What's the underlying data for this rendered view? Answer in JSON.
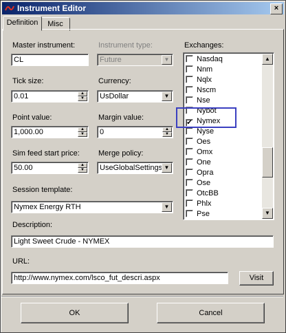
{
  "window": {
    "title": "Instrument Editor",
    "close_glyph": "×"
  },
  "tabs": [
    "Definition",
    "Misc"
  ],
  "form": {
    "master_instrument": {
      "label": "Master instrument:",
      "value": "CL"
    },
    "instrument_type": {
      "label": "Instrument type:",
      "value": "Future"
    },
    "tick_size": {
      "label": "Tick size:",
      "value": "0.01"
    },
    "currency": {
      "label": "Currency:",
      "value": "UsDollar"
    },
    "point_value": {
      "label": "Point value:",
      "value": "1,000.00"
    },
    "margin_value": {
      "label": "Margin value:",
      "value": "0"
    },
    "sim_feed_start_price": {
      "label": "Sim feed start price:",
      "value": "50.00"
    },
    "merge_policy": {
      "label": "Merge policy:",
      "value": "UseGlobalSettings"
    },
    "session_template": {
      "label": "Session template:",
      "value": "Nymex Energy RTH"
    },
    "description": {
      "label": "Description:",
      "value": "Light Sweet Crude - NYMEX"
    },
    "url": {
      "label": "URL:",
      "value": "http://www.nymex.com/lsco_fut_descri.aspx"
    }
  },
  "exchanges": {
    "label": "Exchanges:",
    "items": [
      {
        "name": "Nasdaq",
        "checked": false
      },
      {
        "name": "Nnm",
        "checked": false
      },
      {
        "name": "Nqlx",
        "checked": false
      },
      {
        "name": "Nscm",
        "checked": false
      },
      {
        "name": "Nse",
        "checked": false
      },
      {
        "name": "Nybot",
        "checked": false
      },
      {
        "name": "Nymex",
        "checked": true
      },
      {
        "name": "Nyse",
        "checked": false
      },
      {
        "name": "Oes",
        "checked": false
      },
      {
        "name": "Omx",
        "checked": false
      },
      {
        "name": "One",
        "checked": false
      },
      {
        "name": "Opra",
        "checked": false
      },
      {
        "name": "Ose",
        "checked": false
      },
      {
        "name": "OtcBB",
        "checked": false
      },
      {
        "name": "Phlx",
        "checked": false
      },
      {
        "name": "Pse",
        "checked": false
      }
    ],
    "highlight_color": "#3a3fc0"
  },
  "buttons": {
    "visit": "Visit",
    "ok": "OK",
    "cancel": "Cancel"
  },
  "icons": {
    "spin_up": "▲",
    "spin_down": "▼",
    "dropdown": "▼",
    "check": "✔",
    "scroll_up": "▲",
    "scroll_down": "▼"
  },
  "colors": {
    "title_start": "#0a246a",
    "title_end": "#a6caf0",
    "face": "#d4d0c8"
  }
}
